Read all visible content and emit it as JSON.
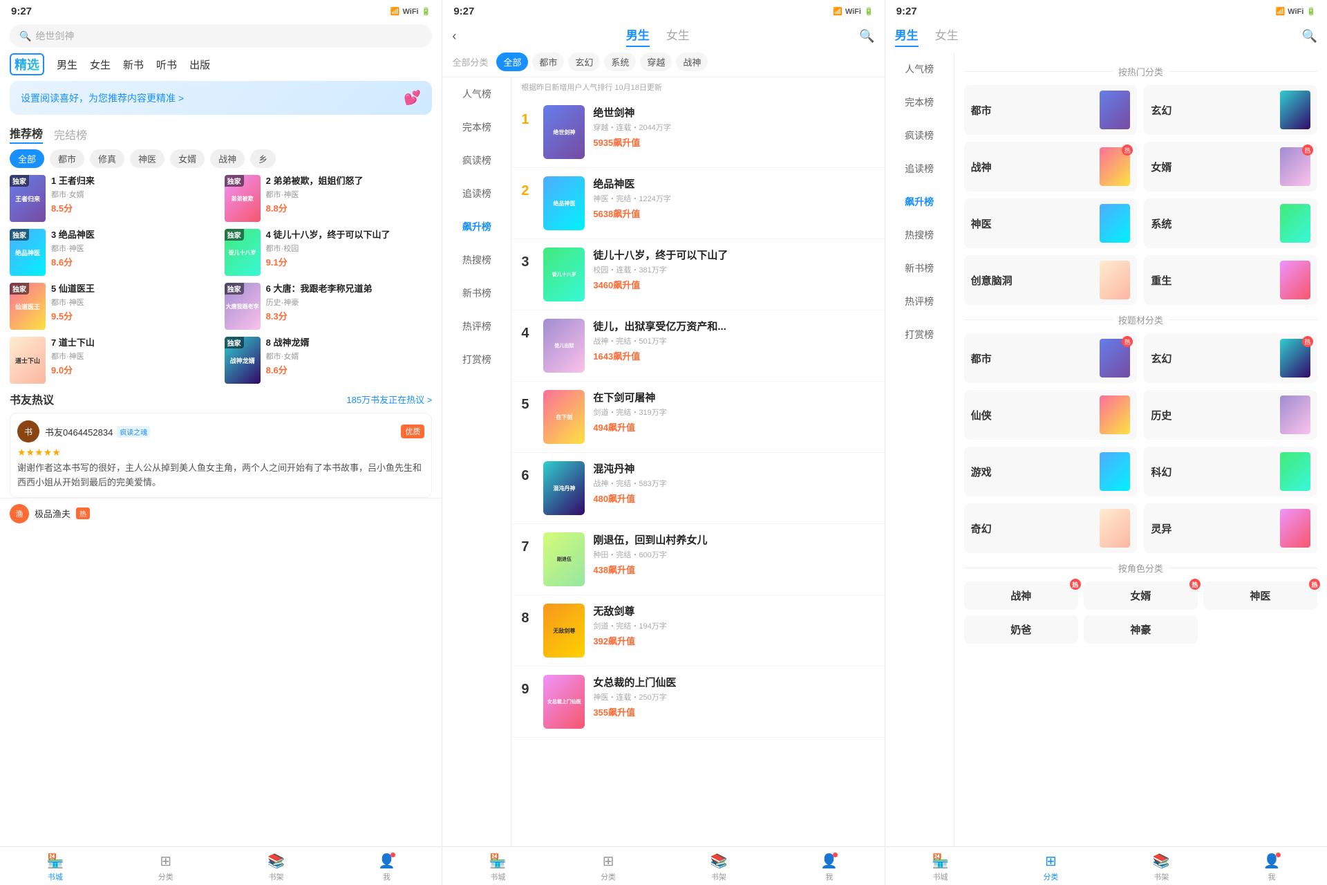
{
  "panels": [
    {
      "id": "panel1",
      "statusBar": {
        "time": "9:27",
        "icons": "..."
      },
      "search": {
        "placeholder": "绝世剑神"
      },
      "nav": {
        "logo": "精选",
        "items": [
          "男生",
          "女生",
          "新书",
          "听书",
          "出版"
        ]
      },
      "banner": {
        "text": "设置阅读喜好，为您推荐内容更精准 >"
      },
      "sections": {
        "rec": "推荐榜",
        "complete": "完结榜"
      },
      "tags": [
        "全部",
        "都市",
        "修真",
        "神医",
        "女婿",
        "战神",
        "乡"
      ],
      "activeTag": "全部",
      "books": [
        {
          "rank": 1,
          "title": "王者归来",
          "tags": "都市・女婿",
          "score": "8.5分",
          "color": "cover-c1"
        },
        {
          "rank": 2,
          "title": "弟弟被欺，姐姐们怒了",
          "tags": "都市・神医",
          "score": "8.8分",
          "color": "cover-c2"
        },
        {
          "rank": 3,
          "title": "绝品神医",
          "tags": "都市・神医",
          "score": "8.6分",
          "color": "cover-c3"
        },
        {
          "rank": 4,
          "title": "徒儿十八岁，终于可以下山了",
          "tags": "都市・校园",
          "score": "9.1分",
          "color": "cover-c4"
        },
        {
          "rank": 5,
          "title": "仙道医王",
          "tags": "都市・神医",
          "score": "9.5分",
          "color": "cover-c5"
        },
        {
          "rank": 6,
          "title": "大唐：我跟老李称兄道弟",
          "tags": "历史・神豪",
          "score": "8.3分",
          "color": "cover-c6"
        },
        {
          "rank": 7,
          "title": "道士下山",
          "tags": "都市・神医",
          "score": "9.0分",
          "color": "cover-c7"
        },
        {
          "rank": 8,
          "title": "战神龙婿",
          "tags": "都市・女婿",
          "score": "8.6分",
          "color": "cover-c8"
        }
      ],
      "hotDiscuss": {
        "title": "书友热议",
        "more": "185万书友正在热议 >",
        "comment": {
          "user": "书友0464452834",
          "badge": "疯读之魂",
          "quality": "优质",
          "stars": "★★★★★",
          "text": "谢谢作者这本书写的很好，主人公从掉到美人鱼女主角，两个人之间开始有了本书故事，吕小鱼先生和西西小姐从开始到最后的完美爱情。"
        },
        "bottomUser": "极品渔夫"
      },
      "bottomNav": [
        "书城",
        "分类",
        "书架",
        "我"
      ]
    },
    {
      "id": "panel2",
      "statusBar": {
        "time": "9:27"
      },
      "header": {
        "mainTabs": [
          "男生",
          "女生"
        ],
        "activeTab": "男生"
      },
      "filterTabs": [
        "全部",
        "都市",
        "玄幻",
        "系统",
        "穿越",
        "战神"
      ],
      "activeFilter": "全部",
      "filterLabel": "全部分类",
      "updateInfo": "根据昨日新增用户人气排行 10月18日更新",
      "sidebar": [
        "人气榜",
        "完本榜",
        "疯读榜",
        "追读榜",
        "飙升榜",
        "热搜榜",
        "新书榜",
        "热评榜",
        "打赏榜"
      ],
      "activeSidebar": "飙升榜",
      "books": [
        {
          "rank": 1,
          "title": "绝世剑神",
          "meta": "穿越・连载・2044万字",
          "hot": "5935飙升值",
          "color": "cover-c1"
        },
        {
          "rank": 2,
          "title": "绝品神医",
          "meta": "神医・完结・1224万字",
          "hot": "5638飙升值",
          "color": "cover-c3"
        },
        {
          "rank": 3,
          "title": "徒儿十八岁，终于可以下山了",
          "meta": "校园・连载・381万字",
          "hot": "3460飙升值",
          "color": "cover-c4"
        },
        {
          "rank": 4,
          "title": "徒儿，出狱享受亿万资产和...",
          "meta": "战神・完结・501万字",
          "hot": "1643飙升值",
          "color": "cover-c6"
        },
        {
          "rank": 5,
          "title": "在下剑可屠神",
          "meta": "剑道・完结・319万字",
          "hot": "494飙升值",
          "color": "cover-c5"
        },
        {
          "rank": 6,
          "title": "混沌丹神",
          "meta": "战神・完结・583万字",
          "hot": "480飙升值",
          "color": "cover-c8"
        },
        {
          "rank": 7,
          "title": "刚退伍，回到山村养女儿",
          "meta": "种田・完结・600万字",
          "hot": "438飙升值",
          "color": "cover-c9"
        },
        {
          "rank": 8,
          "title": "无敌剑尊",
          "meta": "剑道・完结・194万字",
          "hot": "392飙升值",
          "color": "cover-c10"
        },
        {
          "rank": 9,
          "title": "女总裁的上门仙医",
          "meta": "神医・连载・250万字",
          "hot": "355飙升值",
          "color": "cover-c2"
        }
      ],
      "bottomNav": [
        "书城",
        "分类",
        "书架",
        "我"
      ]
    },
    {
      "id": "panel3",
      "statusBar": {
        "time": "9:27"
      },
      "header": {
        "mainTabs": [
          "男生",
          "女生"
        ],
        "activeTab": "男生"
      },
      "sidebar": [
        "人气榜",
        "完本榜",
        "疯读榜",
        "追读榜",
        "飙升榜",
        "热搜榜",
        "新书榜",
        "热评榜",
        "打赏榜"
      ],
      "activeSidebar": "飙升榜",
      "hotCategories": {
        "title": "按热门分类",
        "items": [
          {
            "name": "都市",
            "color": "cover-c1"
          },
          {
            "name": "玄幻",
            "color": "cover-c8"
          },
          {
            "name": "战神",
            "color": "cover-c5",
            "hot": true
          },
          {
            "name": "女婿",
            "color": "cover-c6",
            "hot": true
          },
          {
            "name": "神医",
            "color": "cover-c3"
          },
          {
            "name": "系统",
            "color": "cover-c4"
          },
          {
            "name": "创意脑洞",
            "color": "cover-c7"
          },
          {
            "name": "重生",
            "color": "cover-c2"
          }
        ]
      },
      "themeCategories": {
        "title": "按题材分类",
        "items": [
          {
            "name": "都市",
            "color": "cover-c1",
            "hot": true
          },
          {
            "name": "玄幻",
            "color": "cover-c8",
            "hot": true
          },
          {
            "name": "仙侠",
            "color": "cover-c5"
          },
          {
            "name": "历史",
            "color": "cover-c6"
          },
          {
            "name": "游戏",
            "color": "cover-c3"
          },
          {
            "name": "科幻",
            "color": "cover-c4"
          },
          {
            "name": "奇幻",
            "color": "cover-c7"
          },
          {
            "name": "灵异",
            "color": "cover-c2"
          }
        ]
      },
      "roleCategories": {
        "title": "按角色分类",
        "items": [
          {
            "name": "战神",
            "hot": true
          },
          {
            "name": "女婿",
            "hot": true
          },
          {
            "name": "神医",
            "hot": true
          },
          {
            "name": "奶爸",
            "hot": false
          },
          {
            "name": "神豪",
            "hot": false
          }
        ]
      },
      "bottomNav": [
        "书城",
        "分类",
        "书架",
        "我"
      ],
      "activeBottomNav": "分类"
    }
  ]
}
